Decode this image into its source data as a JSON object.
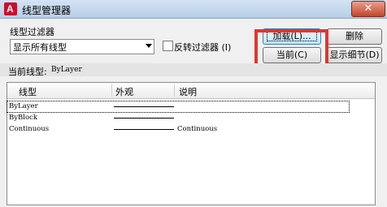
{
  "window": {
    "title": "线型管理器",
    "close": "✕"
  },
  "filter": {
    "label": "线型过滤器",
    "selected": "显示所有线型",
    "invert_label": "反转过滤器 (I)"
  },
  "buttons": {
    "load": "加载(L)...",
    "delete": "删除",
    "current": "当前(C)",
    "show_details": "显示细节(D)"
  },
  "current_linetype": {
    "label": "当前线型:",
    "value": "ByLayer"
  },
  "table": {
    "headers": [
      "线型",
      "外观",
      "说明"
    ],
    "rows": [
      {
        "name": "ByLayer",
        "has_line": true,
        "desc": "",
        "selected": true
      },
      {
        "name": "ByBlock",
        "has_line": true,
        "desc": ""
      },
      {
        "name": "Continuous",
        "has_line": true,
        "desc": "Continuous"
      }
    ]
  },
  "colors": {
    "highlight": "#e8322b",
    "close_button": "#c4452c",
    "app_icon": "#c8102e"
  }
}
